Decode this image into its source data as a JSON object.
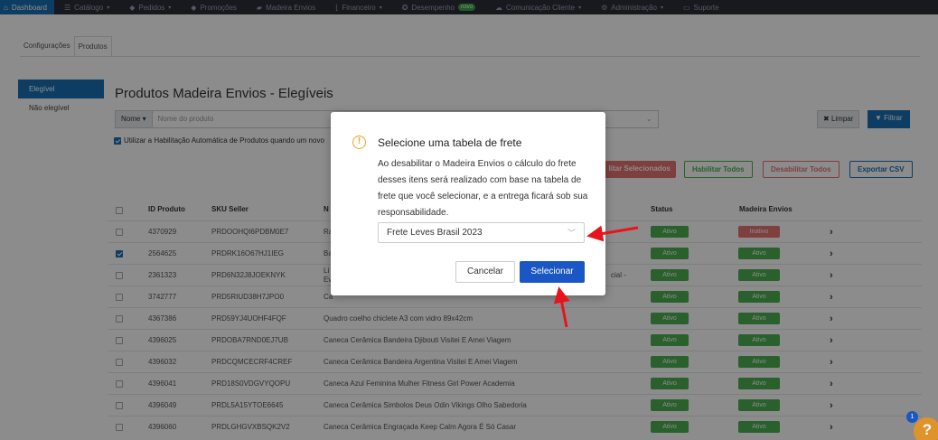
{
  "nav": {
    "items": [
      {
        "label": "Dashboard",
        "icon": "home-icon",
        "active": true,
        "caret": false
      },
      {
        "label": "Catálogo",
        "icon": "list-icon",
        "caret": true
      },
      {
        "label": "Pedidos",
        "icon": "tag-icon",
        "caret": true
      },
      {
        "label": "Promoções",
        "icon": "gift-icon",
        "caret": false
      },
      {
        "label": "Madeira Envios",
        "icon": "truck-icon",
        "caret": false
      },
      {
        "label": "Financeiro",
        "icon": "chart-icon",
        "caret": true
      },
      {
        "label": "Desempenho",
        "icon": "gauge-icon",
        "caret": false,
        "badge": "novo"
      },
      {
        "label": "Comunicação Cliente",
        "icon": "chat-icon",
        "caret": true
      },
      {
        "label": "Administração",
        "icon": "gear-icon",
        "caret": true
      },
      {
        "label": "Suporte",
        "icon": "monitor-icon",
        "caret": false
      }
    ]
  },
  "page_tabs": [
    "Configurações",
    "Produtos"
  ],
  "sidebar": [
    "Elegível",
    "Não elegível"
  ],
  "title": "Produtos Madeira Envios - Elegíveis",
  "filter": {
    "select": "Nome",
    "placeholder": "Nome do produto",
    "clear": "Limpar",
    "filter": "Filtrar"
  },
  "auto_enable": "Utilizar a Habilitação Automática de Produtos quando um novo",
  "actions": {
    "disable_selected": "litar Selecionados",
    "enable_all": "Habilitar Todos",
    "disable_all": "Desabilitar Todos",
    "export": "Exportar CSV"
  },
  "table": {
    "headers": {
      "id": "ID Produto",
      "sku": "SKU Seller",
      "name": "N",
      "status": "Status",
      "envios": "Madeira Envios"
    },
    "rows": [
      {
        "id": "4370929",
        "sku": "PRDOOHQI6PDBM0E7",
        "name": "Ra",
        "extra": "",
        "status": "Ativo",
        "envios": "Inativo",
        "checked": false
      },
      {
        "id": "2564625",
        "sku": "PRDRK16O67HJ1IEG",
        "name": "Ba",
        "extra": "",
        "status": "Ativo",
        "envios": "Ativo",
        "checked": true
      },
      {
        "id": "2361323",
        "sku": "PRD6N32J8JOEKNYK",
        "name": "Li",
        "name2": "Ev",
        "extra": "cial -",
        "status": "Ativo",
        "envios": "Ativo",
        "checked": false
      },
      {
        "id": "3742777",
        "sku": "PRD5RIUD38H7JPO0",
        "name": "Ca",
        "extra": "",
        "status": "Ativo",
        "envios": "Ativo",
        "checked": false
      },
      {
        "id": "4367386",
        "sku": "PRD59YJ4UOHF4FQF",
        "name": "Quadro coelho chiclete A3 com vidro 89x42cm",
        "extra": "",
        "status": "Ativo",
        "envios": "Ativo",
        "checked": false
      },
      {
        "id": "4396025",
        "sku": "PRDOBA7RND0EJ7UB",
        "name": "Caneca Cerâmica Bandeira Djibouti Visitei E Amei Viagem",
        "extra": "",
        "status": "Ativo",
        "envios": "Ativo",
        "checked": false
      },
      {
        "id": "4396032",
        "sku": "PRDCQMCECRF4CREF",
        "name": "Caneca Cerâmica Bandeira Argentina Visitei E Amei Viagem",
        "extra": "",
        "status": "Ativo",
        "envios": "Ativo",
        "checked": false
      },
      {
        "id": "4396041",
        "sku": "PRD18S0VDGVYQOPU",
        "name": "Caneca Azul Feminina Mulher Fitness Girl Power Academia",
        "extra": "",
        "status": "Ativo",
        "envios": "Ativo",
        "checked": false
      },
      {
        "id": "4396049",
        "sku": "PRDL5A15YTOE6645",
        "name": "Caneca Cerâmica Simbolos Deus Odin Vikings Olho Sabedoria",
        "extra": "",
        "status": "Ativo",
        "envios": "Ativo",
        "checked": false
      },
      {
        "id": "4396060",
        "sku": "PRDLGHGVXBSQK2V2",
        "name": "Caneca Cerâmica Engraçada Keep Calm Agora É Só Casar",
        "extra": "",
        "status": "Ativo",
        "envios": "Ativo",
        "checked": false
      }
    ]
  },
  "modal": {
    "icon": "warning-icon",
    "title": "Selecione uma tabela de frete",
    "body": "Ao desabilitar o Madeira Envios o cálculo do frete desses itens será realizado com base na tabela de frete que você selecionar, e a entrega ficará sob sua responsabilidade.",
    "selected": "Frete Leves Brasil 2023",
    "cancel": "Cancelar",
    "confirm": "Selecionar"
  },
  "help": {
    "count": "1",
    "symbol": "?"
  },
  "colors": {
    "accent": "#1a6fb5",
    "confirm": "#1a56c4",
    "active": "#4caf50",
    "inactive": "#e57373",
    "annotation": "#e8141c"
  }
}
